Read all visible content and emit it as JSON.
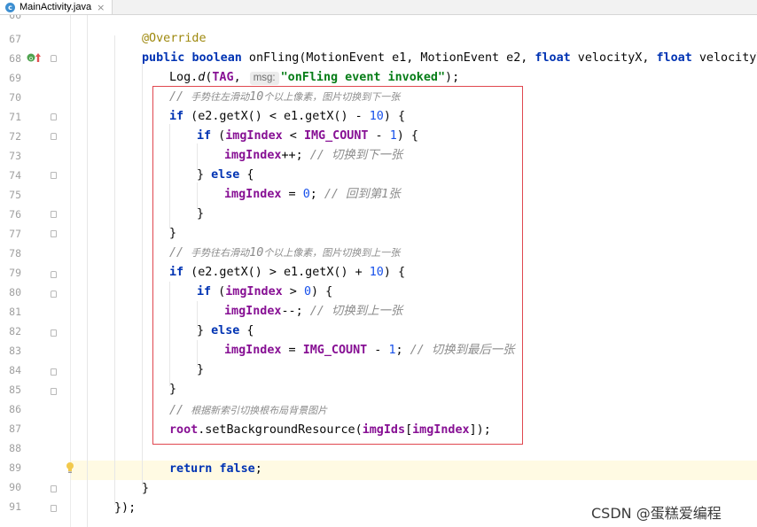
{
  "tab": {
    "icon": "java-class-icon",
    "label": "MainActivity.java",
    "close": "×"
  },
  "lines": [
    {
      "n": "66",
      "code": ""
    },
    {
      "n": "67",
      "code": "@Override"
    },
    {
      "n": "68",
      "code": "public boolean onFling(MotionEvent e1, MotionEvent e2, float velocityX, float velocityY) {"
    },
    {
      "n": "69",
      "code": "Log.d(TAG,  msg: \"onFling event invoked\");"
    },
    {
      "n": "70",
      "code": "// 手势往左滑动10个以上像素，图片切换到下一张"
    },
    {
      "n": "71",
      "code": "if (e2.getX() < e1.getX() - 10) {"
    },
    {
      "n": "72",
      "code": "if (imgIndex < IMG_COUNT - 1) {"
    },
    {
      "n": "73",
      "code": "imgIndex++; // 切换到下一张"
    },
    {
      "n": "74",
      "code": "} else {"
    },
    {
      "n": "75",
      "code": "imgIndex = 0; // 回到第1张"
    },
    {
      "n": "76",
      "code": "}"
    },
    {
      "n": "77",
      "code": "}"
    },
    {
      "n": "78",
      "code": "// 手势往右滑动10个以上像素，图片切换到上一张"
    },
    {
      "n": "79",
      "code": "if (e2.getX() > e1.getX() + 10) {"
    },
    {
      "n": "80",
      "code": "if (imgIndex > 0) {"
    },
    {
      "n": "81",
      "code": "imgIndex--; // 切换到上一张"
    },
    {
      "n": "82",
      "code": "} else {"
    },
    {
      "n": "83",
      "code": "imgIndex = IMG_COUNT - 1; // 切换到最后一张"
    },
    {
      "n": "84",
      "code": "}"
    },
    {
      "n": "85",
      "code": "}"
    },
    {
      "n": "86",
      "code": "// 根据新索引切换根布局背景图片"
    },
    {
      "n": "87",
      "code": "root.setBackgroundResource(imgIds[imgIndex]);"
    },
    {
      "n": "88",
      "code": ""
    },
    {
      "n": "89",
      "code": "return false;"
    },
    {
      "n": "90",
      "code": "}"
    },
    {
      "n": "91",
      "code": "});"
    }
  ],
  "tokens": {
    "annotation": "@Override",
    "l68": {
      "public": "public",
      "boolean": "boolean",
      "rest1": " onFling(MotionEvent e1, MotionEvent e2, ",
      "float1": "float",
      "rest2": " velocityX, ",
      "float2": "float",
      "rest3": " velocityY) {"
    },
    "l69": {
      "pre": "Log.",
      "meth": "d",
      "open": "(",
      "tag": "TAG",
      "comma": ", ",
      "hint": "msg:",
      "str": "\"onFling event invoked\"",
      "end": ");"
    },
    "l70": {
      "slashes": "// ",
      "text1": "手势往左滑动",
      "num": "10",
      "text2": "个以上像素，图片切换到下一张"
    },
    "l71": {
      "if": "if",
      "a": " (e2.getX() < e1.getX() - ",
      "num": "10",
      "b": ") {"
    },
    "l72": {
      "if": "if",
      "a": " (",
      "v": "imgIndex",
      "b": " < ",
      "c": "IMG_COUNT",
      "d": " - ",
      "num": "1",
      "e": ") {"
    },
    "l73": {
      "v": "imgIndex",
      "a": "++; ",
      "cmt": "// 切换到下一张"
    },
    "l74": {
      "a": "} ",
      "else": "else",
      "b": " {"
    },
    "l75": {
      "v": "imgIndex",
      "a": " = ",
      "num": "0",
      "b": "; ",
      "cmt": "// 回到第1张"
    },
    "l76": "}",
    "l77": "}",
    "l78": {
      "slashes": "// ",
      "text1": "手势往右滑动",
      "num": "10",
      "text2": "个以上像素，图片切换到上一张"
    },
    "l79": {
      "if": "if",
      "a": " (e2.getX() > e1.getX() + ",
      "num": "10",
      "b": ") {"
    },
    "l80": {
      "if": "if",
      "a": " (",
      "v": "imgIndex",
      "b": " > ",
      "num": "0",
      "c": ") {"
    },
    "l81": {
      "v": "imgIndex",
      "a": "--; ",
      "cmt": "// 切换到上一张"
    },
    "l82": {
      "a": "} ",
      "else": "else",
      "b": " {"
    },
    "l83": {
      "v": "imgIndex",
      "a": " = ",
      "c": "IMG_COUNT",
      "d": " - ",
      "num": "1",
      "b": "; ",
      "cmt": "// 切换到最后一张"
    },
    "l84": "}",
    "l85": "}",
    "l86": {
      "slashes": "// ",
      "text": "根据新索引切换根布局背景图片"
    },
    "l87": {
      "root": "root",
      "a": ".setBackgroundResource(",
      "arr": "imgIds",
      "b": "[",
      "v": "imgIndex",
      "c": "]);"
    },
    "l89": {
      "return": "return",
      "sp": " ",
      "false": "false",
      "end": ";"
    },
    "l90": "}",
    "l91": "});"
  },
  "colors": {
    "keyword": "#0033b3",
    "field": "#871094",
    "number": "#1750eb",
    "string": "#067d17",
    "comment": "#8c8c8c",
    "annotation": "#9e880d",
    "highlight_box": "#e0474f",
    "current_line": "#fffae3"
  },
  "watermark": "CSDN @蛋糕爱编程"
}
